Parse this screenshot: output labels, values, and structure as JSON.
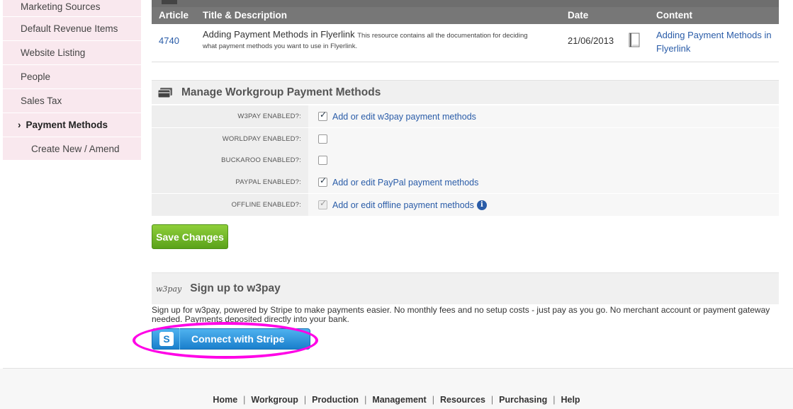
{
  "sidebar": {
    "items": [
      {
        "label": "Marketing Sources"
      },
      {
        "label": "Default Revenue Items"
      },
      {
        "label": "Website Listing"
      },
      {
        "label": "People"
      },
      {
        "label": "Sales Tax"
      },
      {
        "label": "Payment Methods"
      },
      {
        "label": "Create New / Amend"
      }
    ]
  },
  "resources": {
    "headers": [
      "Article",
      "Title & Description",
      "Date",
      "Content"
    ],
    "row": {
      "article": "4740",
      "title": "Adding Payment Methods in Flyerlink",
      "description": "This resource contains all the documentation for deciding what payment methods you want to use in Flyerlink.",
      "date": "21/06/2013",
      "content_link": "Adding Payment Methods in Flyerlink"
    }
  },
  "payment_panel": {
    "title": "Manage Workgroup Payment Methods",
    "rows": [
      {
        "label": "W3PAY ENABLED?:",
        "checked": true,
        "link": "Add or edit w3pay payment methods"
      },
      {
        "label": "WORLDPAY ENABLED?:",
        "checked": false,
        "link": ""
      },
      {
        "label": "BUCKAROO ENABLED?:",
        "checked": false,
        "link": ""
      },
      {
        "label": "PAYPAL ENABLED?:",
        "checked": true,
        "link": "Add or edit PayPal payment methods"
      },
      {
        "label": "OFFLINE ENABLED?:",
        "checked": true,
        "link": "Add or edit offline payment methods"
      }
    ],
    "save_label": "Save Changes"
  },
  "w3pay": {
    "logo": "w3pay",
    "title": "Sign up to w3pay",
    "text": "Sign up for w3pay, powered by Stripe to make payments easier. No monthly fees and no setup costs - just pay as you go. No merchant account or payment gateway needed. Payments deposited directly into your bank.",
    "button": "Connect with Stripe",
    "button_glyph": "S"
  },
  "footer": {
    "links": [
      "Home",
      "Workgroup",
      "Production",
      "Management",
      "Resources",
      "Purchasing",
      "Help"
    ]
  },
  "colors": {
    "sidebar_bg": "#f9e8ee",
    "link": "#2a5ca8",
    "save_green": "#6cb524",
    "stripe_blue": "#2a93dd",
    "highlight": "#ff00e6"
  }
}
